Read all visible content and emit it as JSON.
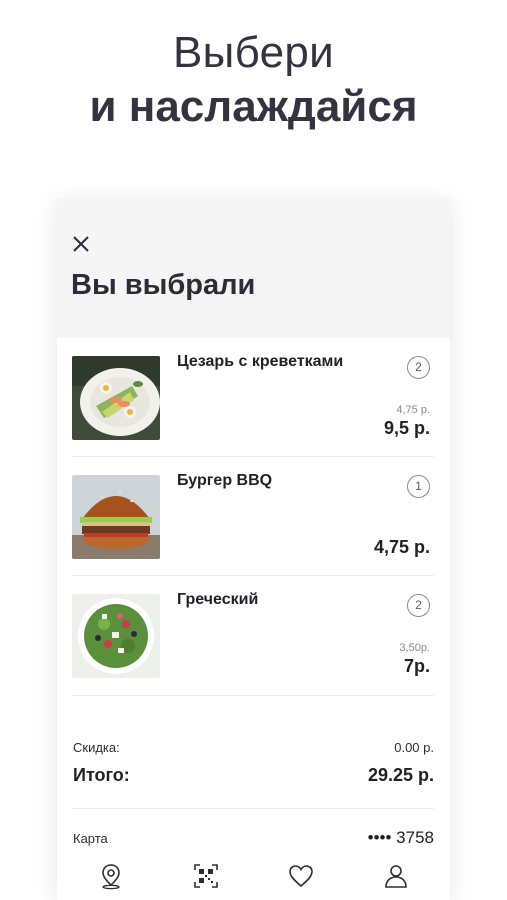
{
  "hero": {
    "line1": "Выбери",
    "line2": "и наслаждайся"
  },
  "card": {
    "title": "Вы выбрали"
  },
  "items": [
    {
      "name": "Цезарь с креветками",
      "qty": "2",
      "unit_price": "4,75 р.",
      "price": "9,5 р."
    },
    {
      "name": "Бургер BBQ",
      "qty": "1",
      "unit_price": "",
      "price": "4,75 р."
    },
    {
      "name": "Греческий",
      "qty": "2",
      "unit_price": "3,50р.",
      "price": "7р."
    }
  ],
  "summary": {
    "discount_label": "Скидка:",
    "discount_value": "0.00 р.",
    "total_label": "Итого:",
    "total_value": "29.25 р.",
    "card_label": "Карта",
    "card_value": "•••• 3758"
  },
  "tabbar": {
    "icons": [
      "location-pin-icon",
      "qr-code-icon",
      "heart-icon",
      "user-icon"
    ]
  },
  "colors": {
    "text": "#1f2028",
    "muted": "#8a8b92",
    "header_bg": "#f5f5f6"
  }
}
